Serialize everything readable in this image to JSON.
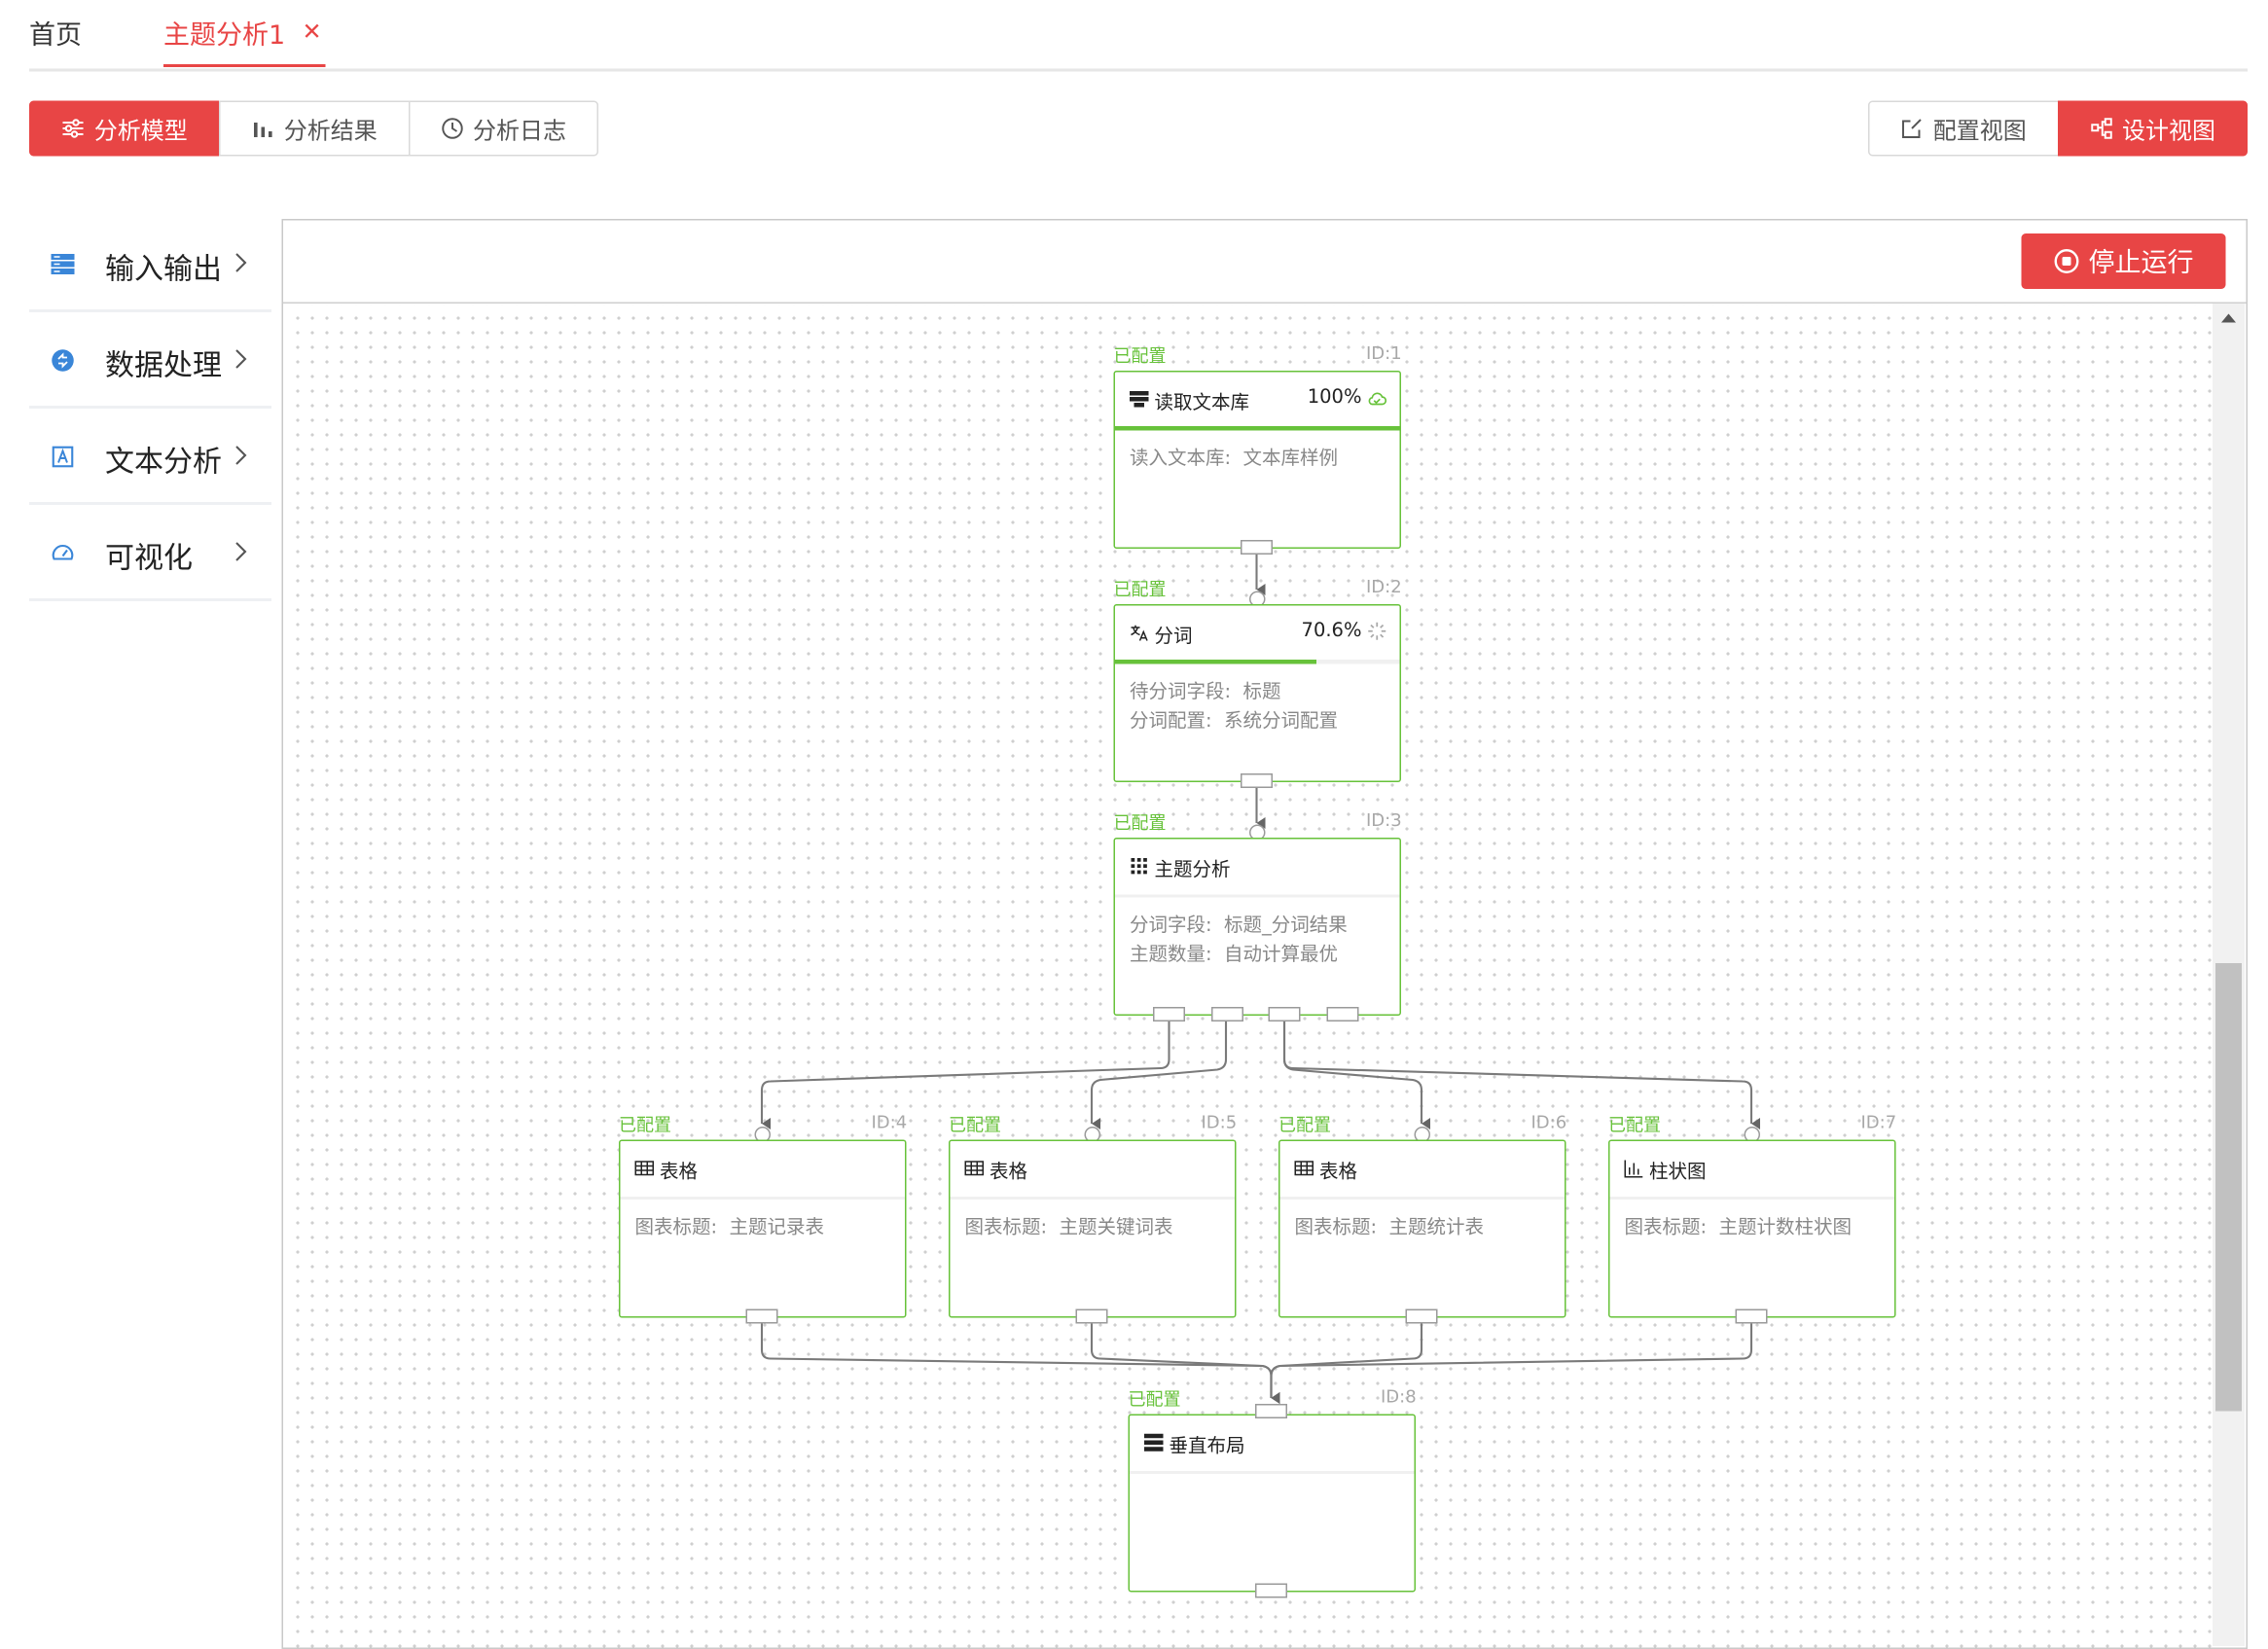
{
  "tabs": [
    {
      "label": "首页"
    },
    {
      "label": "主题分析1"
    }
  ],
  "view_tabs": [
    {
      "label": "分析模型",
      "icon": "sliders-icon"
    },
    {
      "label": "分析结果",
      "icon": "bar-chart-icon"
    },
    {
      "label": "分析日志",
      "icon": "clock-icon"
    }
  ],
  "view_modes": [
    {
      "label": "配置视图",
      "icon": "edit-icon"
    },
    {
      "label": "设计视图",
      "icon": "share-nodes-icon"
    }
  ],
  "sidebar": {
    "items": [
      {
        "label": "输入输出",
        "icon": "server-icon"
      },
      {
        "label": "数据处理",
        "icon": "process-icon"
      },
      {
        "label": "文本分析",
        "icon": "letter-a-icon"
      },
      {
        "label": "可视化",
        "icon": "dashboard-icon"
      }
    ]
  },
  "toolbar": {
    "stop_label": "停止运行"
  },
  "colors": {
    "accent": "#e84545",
    "success": "#67c23a",
    "port_border": "#9a9a9a"
  },
  "nodes": [
    {
      "id": "ID:1",
      "status": "已配置",
      "title": "读取文本库",
      "progress_text": "100%",
      "progress_value": 1.0,
      "fields": [
        {
          "label": "读入文本库:",
          "value": "文本库样例"
        }
      ]
    },
    {
      "id": "ID:2",
      "status": "已配置",
      "title": "分词",
      "progress_text": "70.6%",
      "progress_value": 0.706,
      "fields": [
        {
          "label": "待分词字段:",
          "value": "标题"
        },
        {
          "label": "分词配置:",
          "value": "系统分词配置"
        }
      ]
    },
    {
      "id": "ID:3",
      "status": "已配置",
      "title": "主题分析",
      "fields": [
        {
          "label": "分词字段:",
          "value": "标题_分词结果"
        },
        {
          "label": "主题数量:",
          "value": "自动计算最优"
        }
      ]
    },
    {
      "id": "ID:4",
      "status": "已配置",
      "title": "表格",
      "fields": [
        {
          "label": "图表标题:",
          "value": "主题记录表"
        }
      ]
    },
    {
      "id": "ID:5",
      "status": "已配置",
      "title": "表格",
      "fields": [
        {
          "label": "图表标题:",
          "value": "主题关键词表"
        }
      ]
    },
    {
      "id": "ID:6",
      "status": "已配置",
      "title": "表格",
      "fields": [
        {
          "label": "图表标题:",
          "value": "主题统计表"
        }
      ]
    },
    {
      "id": "ID:7",
      "status": "已配置",
      "title": "柱状图",
      "fields": [
        {
          "label": "图表标题:",
          "value": "主题计数柱状图"
        }
      ]
    },
    {
      "id": "ID:8",
      "status": "已配置",
      "title": "垂直布局",
      "fields": []
    }
  ]
}
